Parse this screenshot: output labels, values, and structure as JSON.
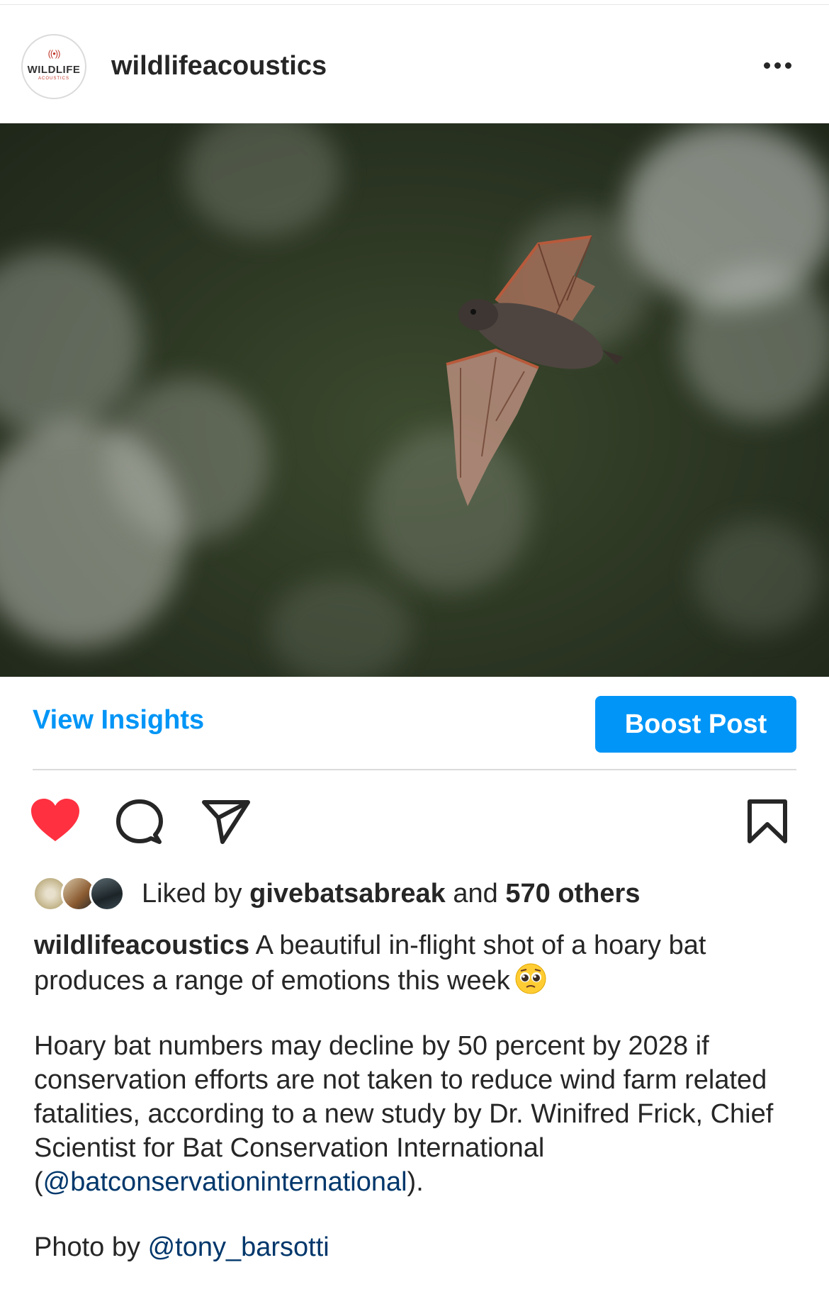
{
  "post": {
    "username": "wildlifeacoustics",
    "avatar_text": "WILDLIFE",
    "avatar_subtext": "ACOUSTICS",
    "avatar_waves": "((•))"
  },
  "actions": {
    "view_insights": "View Insights",
    "boost_post": "Boost Post"
  },
  "likes": {
    "prefix": "Liked by",
    "user": "givebatsabreak",
    "middle": "and",
    "others": "570 others"
  },
  "caption": {
    "username": "wildlifeacoustics",
    "line1": "A beautiful in-flight shot of a hoary bat produces a range of emotions this week",
    "para2_text": "Hoary bat numbers may decline by 50 percent by 2028 if conservation efforts are not taken to reduce wind farm related fatalities, according to a new study by Dr. Winifred Frick, Chief Scientist for Bat Conservation International (",
    "para2_mention": "@batconservationinternational",
    "para2_end": ").",
    "photo_credit_prefix": "Photo by",
    "photo_credit_mention": "@tony_barsotti"
  },
  "icons": {
    "like": "heart-filled-icon",
    "comment": "comment-icon",
    "share": "send-icon",
    "save": "bookmark-icon",
    "more": "more-options-icon",
    "caption_emoji": "pleading-face-emoji"
  },
  "colors": {
    "accent": "#0095f6",
    "heart": "#ff3040",
    "mention": "#00376b",
    "text": "#262626"
  }
}
